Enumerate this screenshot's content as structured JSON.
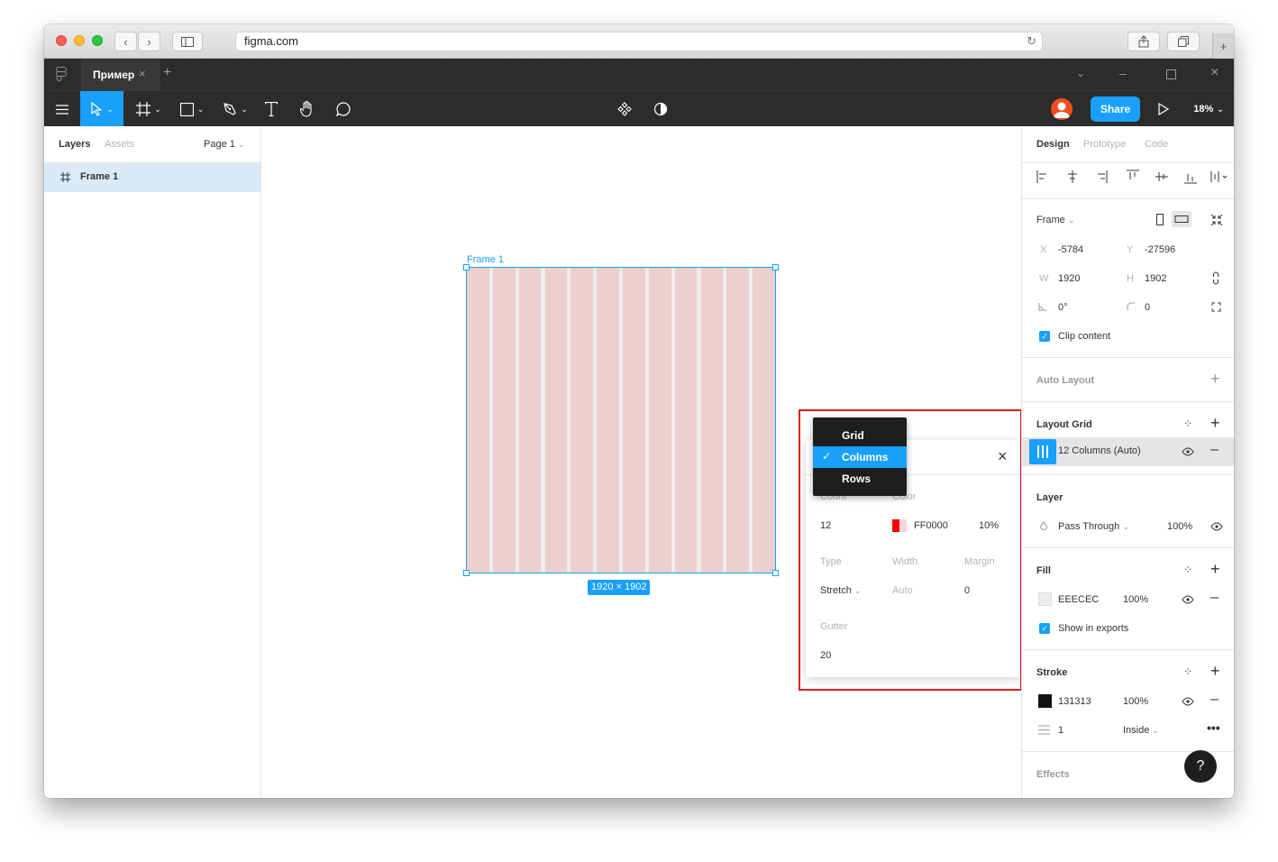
{
  "browser": {
    "url": "figma.com"
  },
  "tabbar": {
    "tab_title": "Пример"
  },
  "toolbar": {
    "share_label": "Share",
    "zoom": "18%"
  },
  "left_panel": {
    "tabs": [
      "Layers",
      "Assets"
    ],
    "page": "Page 1",
    "layers": [
      {
        "name": "Frame 1"
      }
    ]
  },
  "canvas": {
    "frame_label": "Frame 1",
    "size_badge": "1920 × 1902",
    "column_count": 12
  },
  "grid_popup": {
    "menu": [
      "Grid",
      "Columns",
      "Rows"
    ],
    "selected": "Columns",
    "count_label": "Count",
    "color_label": "Color",
    "count": "12",
    "color_hex": "FF0000",
    "opacity": "10%",
    "type_label": "Type",
    "width_label": "Width",
    "margin_label": "Margin",
    "type": "Stretch",
    "width": "Auto",
    "margin": "0",
    "gutter_label": "Gutter",
    "gutter": "20",
    "highlight_color": "#e01b1b"
  },
  "right_panel": {
    "tabs": [
      "Design",
      "Prototype",
      "Code"
    ],
    "frame_label": "Frame",
    "x_label": "X",
    "x": "-5784",
    "y_label": "Y",
    "y": "-27596",
    "w_label": "W",
    "w": "1920",
    "h_label": "H",
    "h": "1902",
    "rotation": "0°",
    "radius": "0",
    "clip_content": "Clip content",
    "auto_layout": "Auto Layout",
    "layout_grid": "Layout Grid",
    "grid_item": "12 Columns (Auto)",
    "layer": "Layer",
    "blend": "Pass Through",
    "layer_opacity": "100%",
    "fill": "Fill",
    "fill_hex": "EEECEC",
    "fill_opacity": "100%",
    "show_exports": "Show in exports",
    "stroke": "Stroke",
    "stroke_hex": "131313",
    "stroke_opacity": "100%",
    "stroke_width": "1",
    "stroke_align": "Inside",
    "effects": "Effects",
    "help": "?"
  }
}
